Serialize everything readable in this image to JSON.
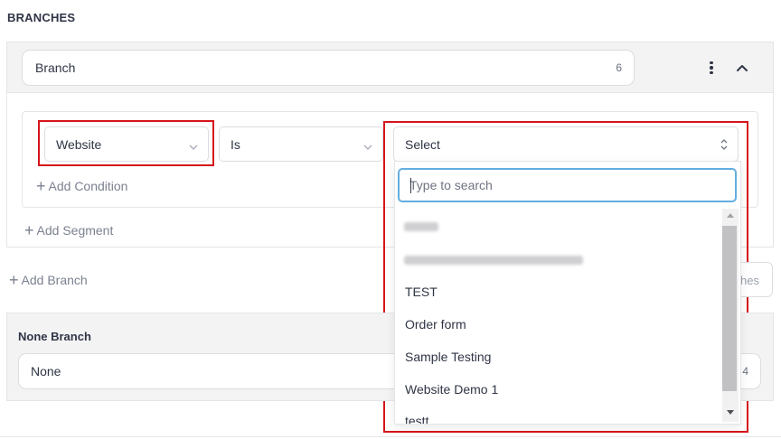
{
  "section": {
    "title": "BRANCHES"
  },
  "branch": {
    "name": "Branch",
    "count": "6"
  },
  "condition": {
    "field": "Website",
    "operator": "Is",
    "value_placeholder": "Select",
    "add_condition": "Add Condition"
  },
  "add_segment": "Add Segment",
  "add_branch": "Add Branch",
  "partial_button": "hes",
  "none_branch": {
    "title": "None Branch",
    "name": "None",
    "count": "4"
  },
  "dropdown": {
    "search_placeholder": "Type to search",
    "options": [
      "TEST",
      "Order form",
      "Sample Testing",
      "Website Demo 1",
      "testt"
    ]
  },
  "colors": {
    "highlight": "#d6141b",
    "focus": "#63aee0",
    "panel": "#f3f3f4",
    "text": "#2f3545",
    "muted": "#7c8190"
  }
}
